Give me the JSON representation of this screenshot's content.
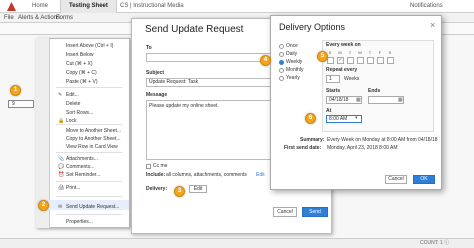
{
  "topbar": {
    "tab_home": "Home",
    "tab_sheet": "Testing Sheet",
    "tab_other": "CS | Instructional Media",
    "notifications": "Notifications"
  },
  "menubar": {
    "items": [
      "File",
      "Alerts & Actions",
      "Forms"
    ]
  },
  "grid": {
    "selected_row": "9"
  },
  "context_menu": {
    "items": [
      {
        "label": "Insert Above (Ctrl + I)",
        "icon": ""
      },
      {
        "label": "Insert Below",
        "icon": ""
      },
      {
        "label": "Cut (⌘ + X)",
        "icon": ""
      },
      {
        "label": "Copy (⌘ + C)",
        "icon": ""
      },
      {
        "label": "Paste (⌘ + V)",
        "icon": ""
      },
      {
        "label": "Edit...",
        "icon": "✎"
      },
      {
        "label": "Delete",
        "icon": ""
      },
      {
        "label": "Sort Rows...",
        "icon": ""
      },
      {
        "label": "Lock",
        "icon": "🔒"
      },
      {
        "label": "Move to Another Sheet...",
        "icon": ""
      },
      {
        "label": "Copy to Another Sheet...",
        "icon": ""
      },
      {
        "label": "View Row in Card View",
        "icon": ""
      },
      {
        "label": "Attachments...",
        "icon": "📎"
      },
      {
        "label": "Comments...",
        "icon": "💬"
      },
      {
        "label": "Set Reminder...",
        "icon": "⏰"
      },
      {
        "label": "Print...",
        "icon": "🖨"
      },
      {
        "label": "Send Update Request...",
        "icon": "✉"
      },
      {
        "label": "Properties...",
        "icon": ""
      }
    ]
  },
  "send_dialog": {
    "title": "Send Update Request",
    "to_label": "To",
    "subject_label": "Subject",
    "subject_value": "Update Request: Task",
    "message_label": "Message",
    "message_value": "Please update my online sheet.",
    "cc_me": "Cc me",
    "include_label": "Include:",
    "include_value": "all columns, attachments, comments",
    "edit_link": "Edit",
    "delivery_label": "Delivery:",
    "delivery_edit": "Edit",
    "cancel": "Cancel",
    "send": "Send"
  },
  "delivery_dialog": {
    "title": "Delivery Options",
    "close": "×",
    "frequencies": [
      "Once",
      "Daily",
      "Weekly",
      "Monthly",
      "Yearly"
    ],
    "selected_frequency": "Weekly",
    "every_week_on": "Every week on",
    "days": [
      "S",
      "M",
      "T",
      "W",
      "T",
      "F",
      "S"
    ],
    "checked_day_index": 1,
    "repeat_every": "Repeat every",
    "repeat_value": "1",
    "repeat_unit": "Weeks",
    "starts_label": "Starts",
    "starts_value": "04/18/18",
    "ends_label": "Ends",
    "at_label": "At",
    "at_value": "8:00 AM",
    "summary_label": "Summary:",
    "summary_value": "Every Week on Monday at 8:00 AM from 04/18/18",
    "first_send_label": "First send date:",
    "first_send_value": "Monday, April 23, 2018 8:00 AM",
    "cancel": "Cancel",
    "ok": "OK"
  },
  "callouts": [
    "1",
    "2",
    "3",
    "4",
    "5",
    "6"
  ],
  "status": {
    "text": "COUNT: 1  ⓘ"
  },
  "colors": {
    "accent": "#2f7fd8",
    "callout": "#f4a51c",
    "logo": "#c0392b"
  }
}
